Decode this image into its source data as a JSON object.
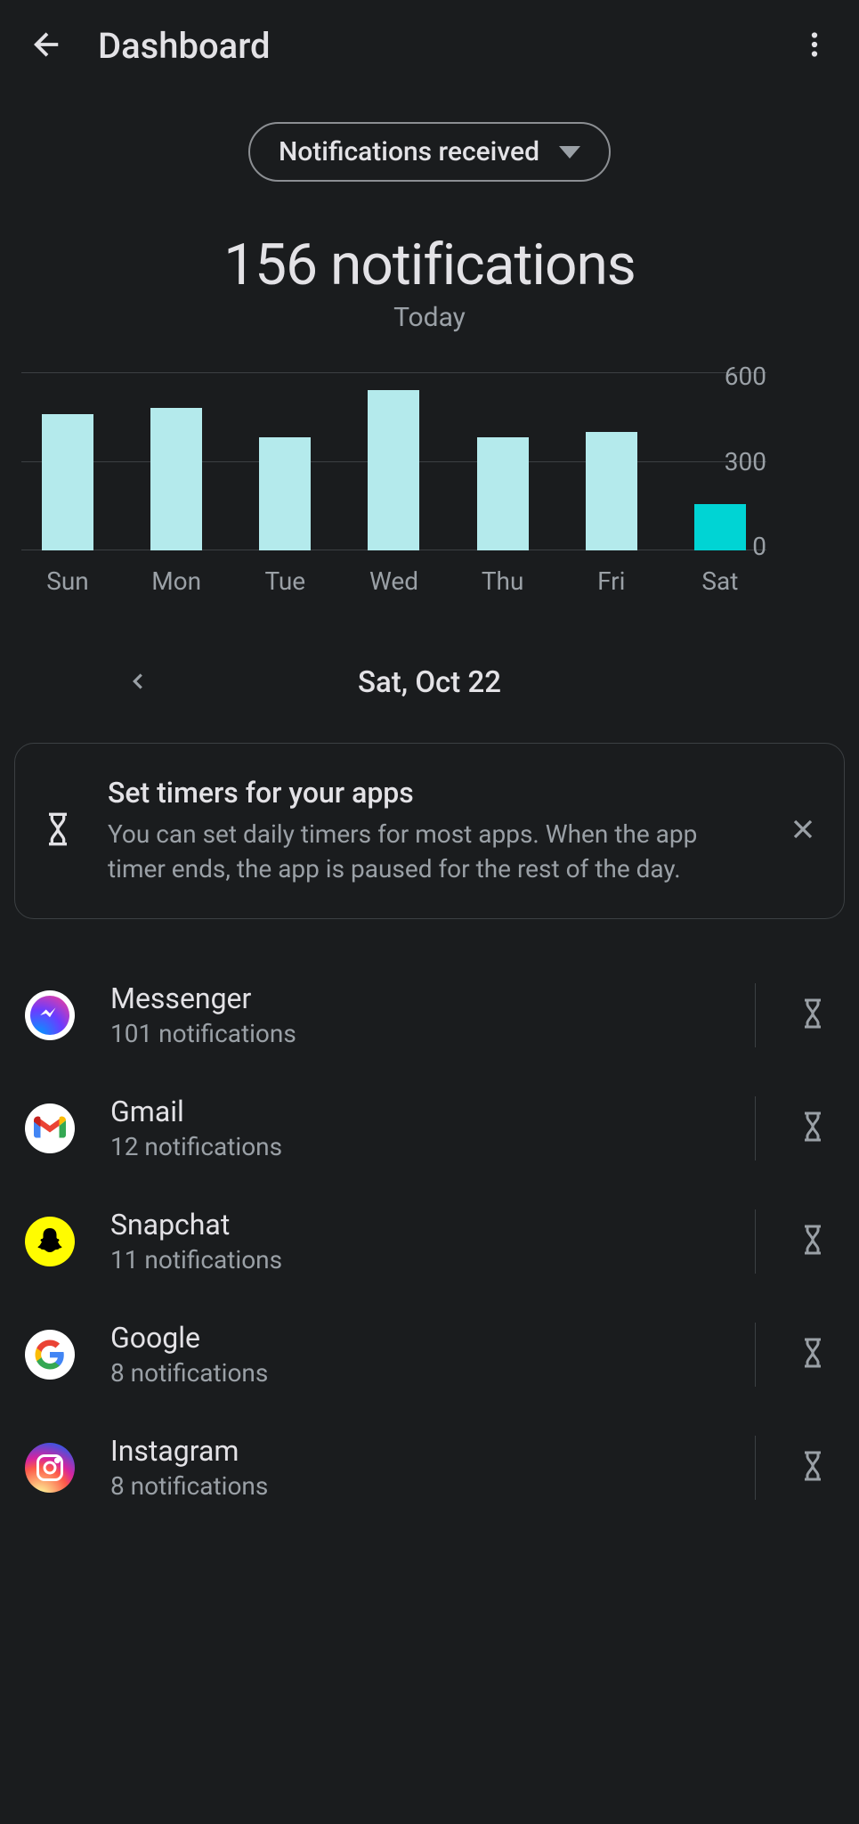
{
  "header": {
    "title": "Dashboard"
  },
  "filter": {
    "label": "Notifications received"
  },
  "summary": {
    "count": "156 notifications",
    "sub": "Today"
  },
  "chart_data": {
    "type": "bar",
    "categories": [
      "Sun",
      "Mon",
      "Tue",
      "Wed",
      "Thu",
      "Fri",
      "Sat"
    ],
    "values": [
      460,
      480,
      380,
      540,
      380,
      400,
      156
    ],
    "title": "",
    "xlabel": "",
    "ylabel": "",
    "ylim": [
      0,
      600
    ],
    "y_ticks": [
      "600",
      "300",
      "0"
    ],
    "selected_index": 6
  },
  "date_nav": {
    "current": "Sat, Oct 22"
  },
  "info_card": {
    "title": "Set timers for your apps",
    "desc": "You can set daily timers for most apps. When the app timer ends, the app is paused for the rest of the day."
  },
  "apps": [
    {
      "name": "Messenger",
      "count": "101 notifications",
      "icon": "messenger"
    },
    {
      "name": "Gmail",
      "count": "12 notifications",
      "icon": "gmail"
    },
    {
      "name": "Snapchat",
      "count": "11 notifications",
      "icon": "snapchat"
    },
    {
      "name": "Google",
      "count": "8 notifications",
      "icon": "google"
    },
    {
      "name": "Instagram",
      "count": "8 notifications",
      "icon": "instagram"
    }
  ]
}
